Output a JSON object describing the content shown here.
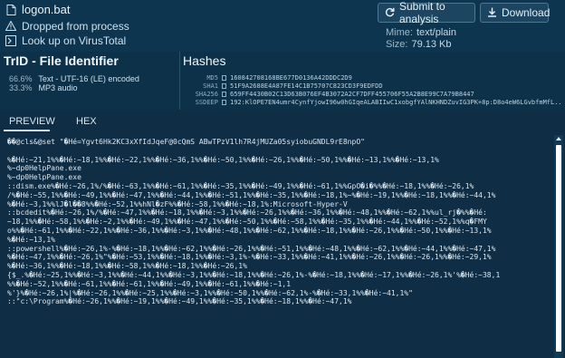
{
  "file": {
    "name": "logon.bat",
    "dropped_label": "Dropped from process",
    "virustotal_label": "Look up on VirusTotal"
  },
  "actions": {
    "submit_label": "Submit to analysis",
    "download_label": "Download"
  },
  "meta": {
    "mime_label": "Mime:",
    "mime_value": "text/plain",
    "size_label": "Size:",
    "size_value": "79.13 Kb"
  },
  "trid": {
    "title": "TrID - File Identifier",
    "rows": [
      {
        "pct": "66.6%",
        "desc": "Text - UTF-16 (LE) encoded"
      },
      {
        "pct": "33.3%",
        "desc": "MP3 audio"
      }
    ]
  },
  "hashes": {
    "title": "Hashes",
    "rows": [
      {
        "label": "MD5",
        "value": "160842708168BE677D0136A42DDDC2D9"
      },
      {
        "label": "SHA1",
        "value": "51F9A2688E4A87FE14C1B75707C823CD3F9EDFDD"
      },
      {
        "label": "SHA256",
        "value": "659FF4430B02C13D63B076EF4B3072A2CF7DFF455706F55A2B8E99C7A79B8447"
      },
      {
        "label": "SSDEEP",
        "value": "192:KlOPE7EN4umr4CynfYjowI96w0hGIqeALABIIwC1xobgfYAlNKHNDZuvIG3PK+8p:D8o4eW6LGvbfmMfL..."
      }
    ]
  },
  "tabs": {
    "preview": "PREVIEW",
    "hex": "HEX"
  },
  "preview_lines": [
    "��@cls&@set \"�Hé=Ygvt6Hk2KC3xXfIdJqeF@0cQmS ABwTPzV1lh7R4jMUZa05syiobuGNDL9rE8npO\"",
    "",
    "%�Hé:~21,1%%�Hé:~18,1%%�Hé:~22,1%%�Hé:~36,1%%�Hé:~50,1%%�Hé:~26,1%%�Hé:~50,1%%�Hé:~13,1%%�Hé:~13,1%",
    "%~dp0HelpPane.exe",
    "%~dp0HelpPane.exe",
    "::dism.exe%�Hé:~26,1%/%�Hé:~63,1%%�Hé:~61,1%%�Hé:~35,1%%�Hé:~49,1%%�Hé:~61,1%%GpO�i�%%�Hé:~18,1%%�Hé:~26,1%",
    "/%�Hé:~55,1%%�Hé:~49,1%%�Hé:~47,1%%�Hé:~44,1%%�Hé:~51,1%%�Hé:~35,1%%�Hé:~18,1%~%�Hé:~19,1%%�Hé:~18,1%%�Hé:~44,1%",
    "%�Hé:~3,1%%lJ�l��8%%�Hé:~52,1%%hNl�zF%%�Hé:~58,1%%�Hé:~18,1%:Microsoft-Hyper-V",
    "::bcdedit%�Hé:~26,1%/%�Hé:~47,1%%�Hé:~18,1%%�Hé:~3,1%%�Hé:~26,1%%�Hé:~36,1%%�Hé:~48,1%%�Hé:~62,1%%ul_rj�%%�Hé:",
    "~18,1%%�Hé:~58,1%%�Hé:~2,1%%�Hé:~49,1%%�Hé:~47,1%%�Hé:~50,1%%�Hé:~58,1%%�Hé:~35,1%%�Hé:~44,1%%�Hé:~52,1%%q�FMY",
    "o%%�Hé:~61,1%%�Hé:~22,1%%�Hé:~36,1%%�Hé:~3,1%%�Hé:~48,1%%�Hé:~62,1%%�Hé:~18,1%%�Hé:~26,1%%�Hé:~50,1%%�Hé:~13,1%",
    "%�Hé:~13,1%",
    "::powershell%�Hé:~26,1%-%�Hé:~18,1%%�Hé:~62,1%%�Hé:~26,1%%�Hé:~51,1%%�Hé:~48,1%%�Hé:~62,1%%�Hé:~44,1%%�Hé:~47,1%",
    "%�Hé:~47,1%%�Hé:~26,1%\"%�Hé:~53,1%%�Hé:~18,1%%�Hé:~3,1%-%�Hé:~33,1%%�Hé:~41,1%%�Hé:~26,1%%�Hé:~26,1%%�Hé:~29,1%",
    "%�Hé:~36,1%%�Hé:~18,1%%�Hé:~58,1%%�Hé:~18,1%%�Hé:~26,1%",
    "{$_.%�Hé:~25,1%%�Hé:~3,1%%�Hé:~44,1%%�Hé:~3,1%%�Hé:~18,1%%�Hé:~26,1%-%�Hé:~18,1%%�Hé:~17,1%%�Hé:~26,1%'%�Hé:~38,1",
    "%%�Hé:~52,1%%�Hé:~61,1%%�Hé:~61,1%%�Hé:~49,1%%�Hé:~61,1%%�Hé:~1,1",
    "%'}%�Hé:~26,1%|%�Hé:~26,1%%�Hé:~25,1%%�Hé:~3,1%%�Hé:~50,1%%�Hé:~62,1%-%�Hé:~33,1%%�Hé:~41,1%\"",
    "::\"c:\\Program%�Hé:~26,1%%�Hé:~19,1%%�Hé:~49,1%%�Hé:~35,1%%�Hé:~18,1%%�Hé:~47,1%"
  ]
}
